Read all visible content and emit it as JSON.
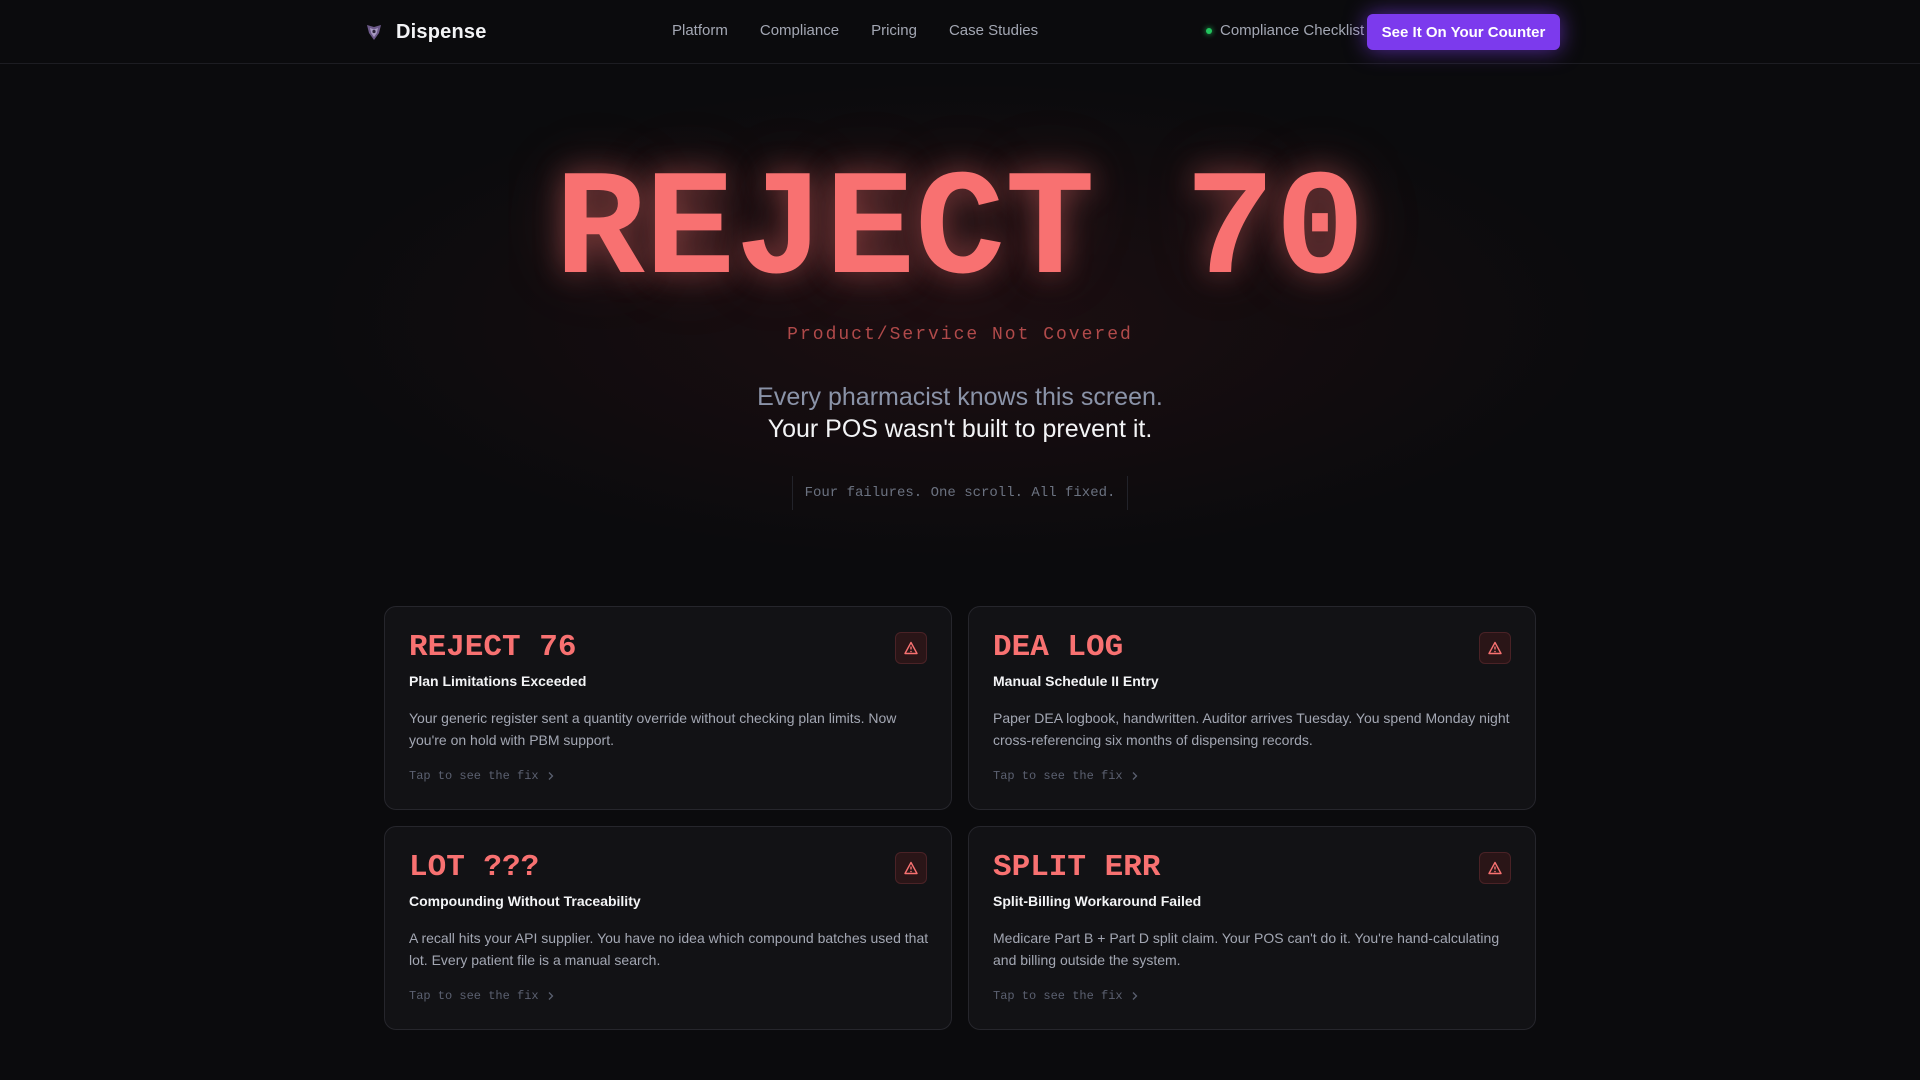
{
  "nav": {
    "brand": "Dispense",
    "links": [
      "Platform",
      "Compliance",
      "Pricing",
      "Case Studies"
    ],
    "checklist": "Compliance Checklist",
    "cta": "See It On Your Counter"
  },
  "hero": {
    "code": "REJECT 70",
    "subtitle": "Product/Service Not Covered",
    "line1": "Every pharmacist knows this screen.",
    "line2": "Your POS wasn't built to prevent it.",
    "note": "Four failures. One scroll. All fixed."
  },
  "cards": [
    {
      "code": "REJECT 76",
      "subtitle": "Plan Limitations Exceeded",
      "description": "Your generic register sent a quantity override without checking plan limits. Now you're on hold with PBM support.",
      "fix": "Tap to see the fix"
    },
    {
      "code": "DEA LOG",
      "subtitle": "Manual Schedule II Entry",
      "description": "Paper DEA logbook, handwritten. Auditor arrives Tuesday. You spend Monday night cross-referencing six months of dispensing records.",
      "fix": "Tap to see the fix"
    },
    {
      "code": "LOT ???",
      "subtitle": "Compounding Without Traceability",
      "description": "A recall hits your API supplier. You have no idea which compound batches used that lot. Every patient file is a manual search.",
      "fix": "Tap to see the fix"
    },
    {
      "code": "SPLIT ERR",
      "subtitle": "Split-Billing Workaround Failed",
      "description": "Medicare Part B + Part D split claim. Your POS can't do it. You're hand-calculating and billing outside the system.",
      "fix": "Tap to see the fix"
    }
  ],
  "colors": {
    "accent": "#7c3aed",
    "error": "#f87171",
    "status_ok": "#22c55e",
    "background": "#0b0b0d"
  },
  "icons": {
    "brand": "logo-icon",
    "card_badge": "alert-triangle-icon",
    "fix_arrow": "chevron-right-icon"
  }
}
